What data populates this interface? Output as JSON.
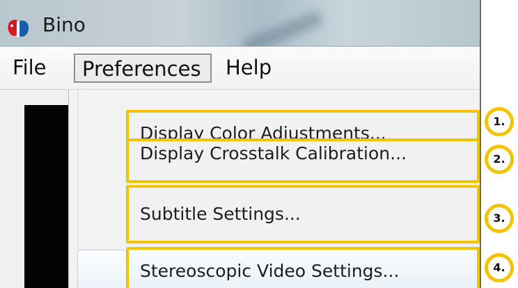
{
  "window": {
    "title": "Bino",
    "icon": "bino-app-icon"
  },
  "menubar": {
    "file": "File",
    "preferences": "Preferences",
    "help": "Help"
  },
  "preferences_menu": {
    "items": [
      {
        "label": "Display Color Adjustments...",
        "annotation": "1."
      },
      {
        "label": "Display Crosstalk Calibration...",
        "annotation": "2."
      },
      {
        "label": "Subtitle Settings...",
        "annotation": "3."
      },
      {
        "label": "Stereoscopic Video Settings...",
        "annotation": "4."
      }
    ]
  },
  "colors": {
    "annotation_border": "#f2c400",
    "menu_background": "#f0f0f0",
    "hover_blue": "#eaf2f8",
    "icon_red": "#d51b22",
    "icon_blue": "#1a5ca8"
  }
}
